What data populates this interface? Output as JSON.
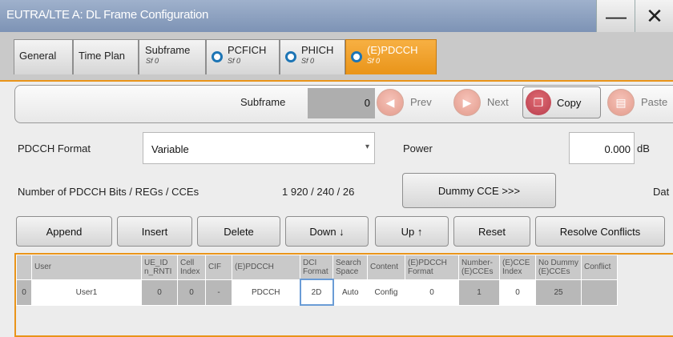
{
  "window": {
    "title": "EUTRA/LTE A: DL Frame Configuration",
    "minimize": "—",
    "close": "✕"
  },
  "tabs": [
    {
      "label": "General"
    },
    {
      "label": "Time Plan"
    },
    {
      "label": "Subframe",
      "sub": "Sf 0"
    },
    {
      "label": "PCFICH",
      "sub": "Sf 0"
    },
    {
      "label": "PHICH",
      "sub": "Sf 0"
    },
    {
      "label": "(E)PDCCH",
      "sub": "Sf 0"
    }
  ],
  "subframe_bar": {
    "label": "Subframe",
    "value": "0",
    "prev": "Prev",
    "next": "Next",
    "copy": "Copy",
    "paste": "Paste"
  },
  "format": {
    "label": "PDCCH Format",
    "value": "Variable"
  },
  "power": {
    "label": "Power",
    "value": "0.000",
    "unit": "dB"
  },
  "bits": {
    "label": "Number of PDCCH Bits / REGs / CCEs",
    "value": "1 920 / 240 / 26",
    "dummy_button": "Dummy CCE >>>",
    "data_label": "Dat"
  },
  "actions": {
    "append": "Append",
    "insert": "Insert",
    "delete": "Delete",
    "down": "Down ↓",
    "up": "Up ↑",
    "reset": "Reset",
    "resolve": "Resolve Conflicts"
  },
  "table": {
    "headers": [
      "User",
      "UE_ID\nn_RNTI",
      "Cell\nIndex",
      "CIF",
      "(E)PDCCH",
      "DCI\nFormat",
      "Search\nSpace",
      "Content",
      "(E)PDCCH\nFormat",
      "Number-\n(E)CCEs",
      "(E)CCE\nIndex",
      "No Dummy\n(E)CCEs",
      "Conflict"
    ],
    "row": {
      "index": "0",
      "user": "User1",
      "ue_id": "0",
      "cell_index": "0",
      "cif": "-",
      "epdcch": "PDCCH",
      "dci_format": "2D",
      "search_space": "Auto",
      "content": "Config",
      "epdcch_format": "0",
      "num_cces": "1",
      "cce_index": "0",
      "no_dummy": "25",
      "conflict": ""
    }
  }
}
